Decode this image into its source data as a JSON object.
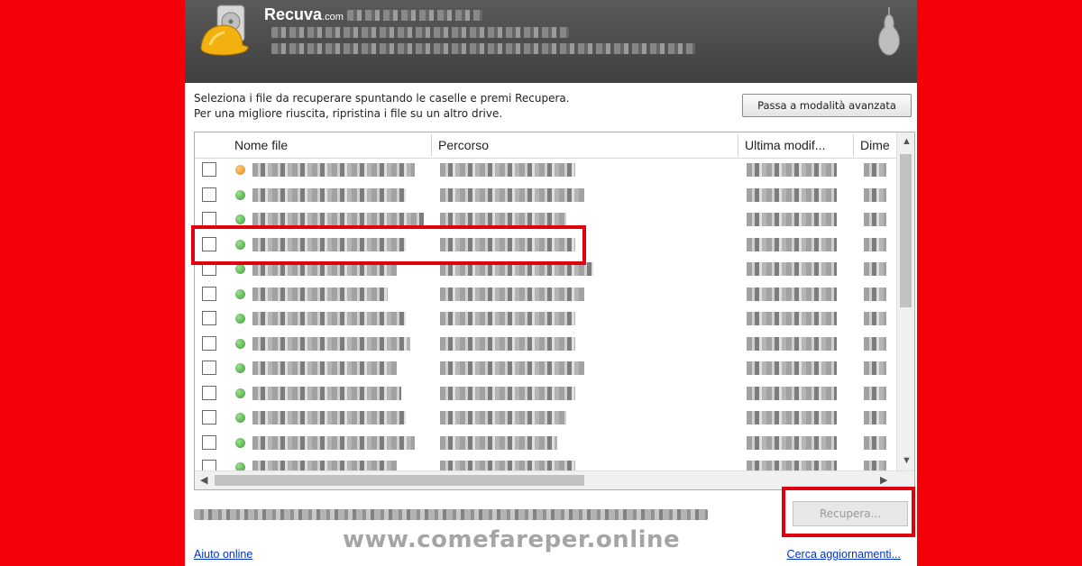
{
  "app": {
    "name": "Recuva",
    "domain_suffix": ".com"
  },
  "instructions": {
    "line1": "Seleziona i file da recuperare spuntando le caselle e premi Recupera.",
    "line2": "Per una migliore riuscita, ripristina i file su un altro drive."
  },
  "buttons": {
    "advanced_mode": "Passa a modalità avanzata",
    "recover": "Recupera..."
  },
  "columns": [
    "Nome file",
    "Percorso",
    "Ultima modif...",
    "Dime"
  ],
  "rows": [
    {
      "status": "orange"
    },
    {
      "status": "green"
    },
    {
      "status": "green"
    },
    {
      "status": "green",
      "highlighted": true
    },
    {
      "status": "green"
    },
    {
      "status": "green"
    },
    {
      "status": "green"
    },
    {
      "status": "green"
    },
    {
      "status": "green"
    },
    {
      "status": "green"
    },
    {
      "status": "green"
    },
    {
      "status": "green"
    },
    {
      "status": "green"
    }
  ],
  "footer": {
    "help_link": "Aiuto online",
    "update_link": "Cerca aggiornamenti..."
  },
  "watermark": "www.comefareper.online",
  "colors": {
    "background": "#f40008",
    "highlight": "#e10010",
    "header": "#4a4a4a",
    "status_green": "#3e9c34",
    "status_orange": "#e5881a",
    "link": "#0033cc"
  },
  "icons": {
    "logo": "hardhat-drive-icon",
    "brand_mark": "pear-icon",
    "status_ok": "green-dot-icon",
    "status_warn": "orange-dot-icon"
  }
}
